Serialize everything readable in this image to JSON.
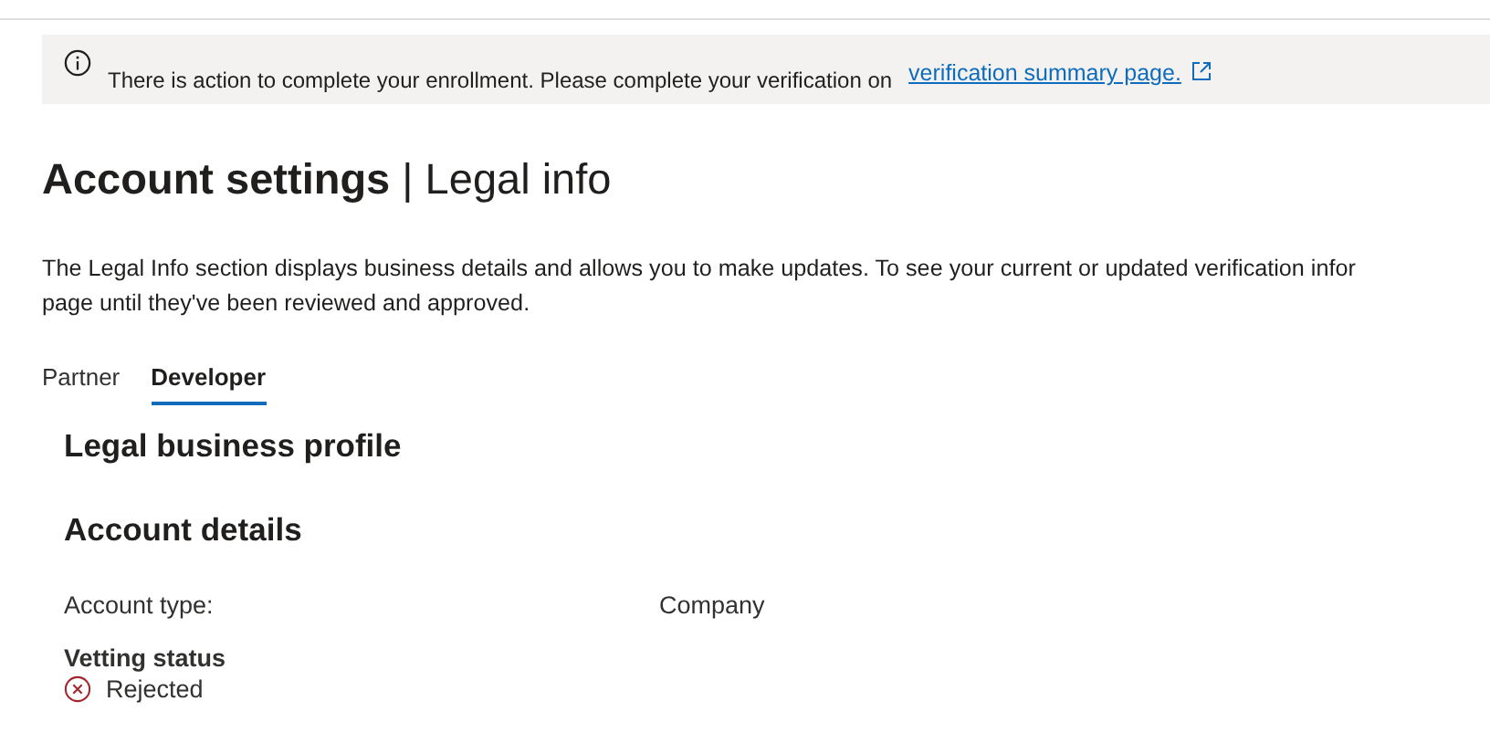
{
  "banner": {
    "message": "There is action to complete your enrollment. Please complete your verification on",
    "link": "verification summary page."
  },
  "title": "**Account settings** | Legal info",
  "description": [
    "The Legal Info section displays business details and allows you to make updates. To see your current or updated verification infor",
    "page until they've been reviewed and approved."
  ],
  "tabs": [
    {
      "label": "Partner",
      "selected": false
    },
    {
      "label": "Developer",
      "selected": true
    }
  ],
  "sections": [
    {
      "heading": "Legal business profile"
    },
    {
      "heading": "Account details"
    }
  ],
  "fields": [
    {
      "label": "Account type:",
      "value": "Company"
    }
  ],
  "vetting": {
    "label": "Vetting status",
    "status": "Rejected",
    "kind": "rejected"
  }
}
